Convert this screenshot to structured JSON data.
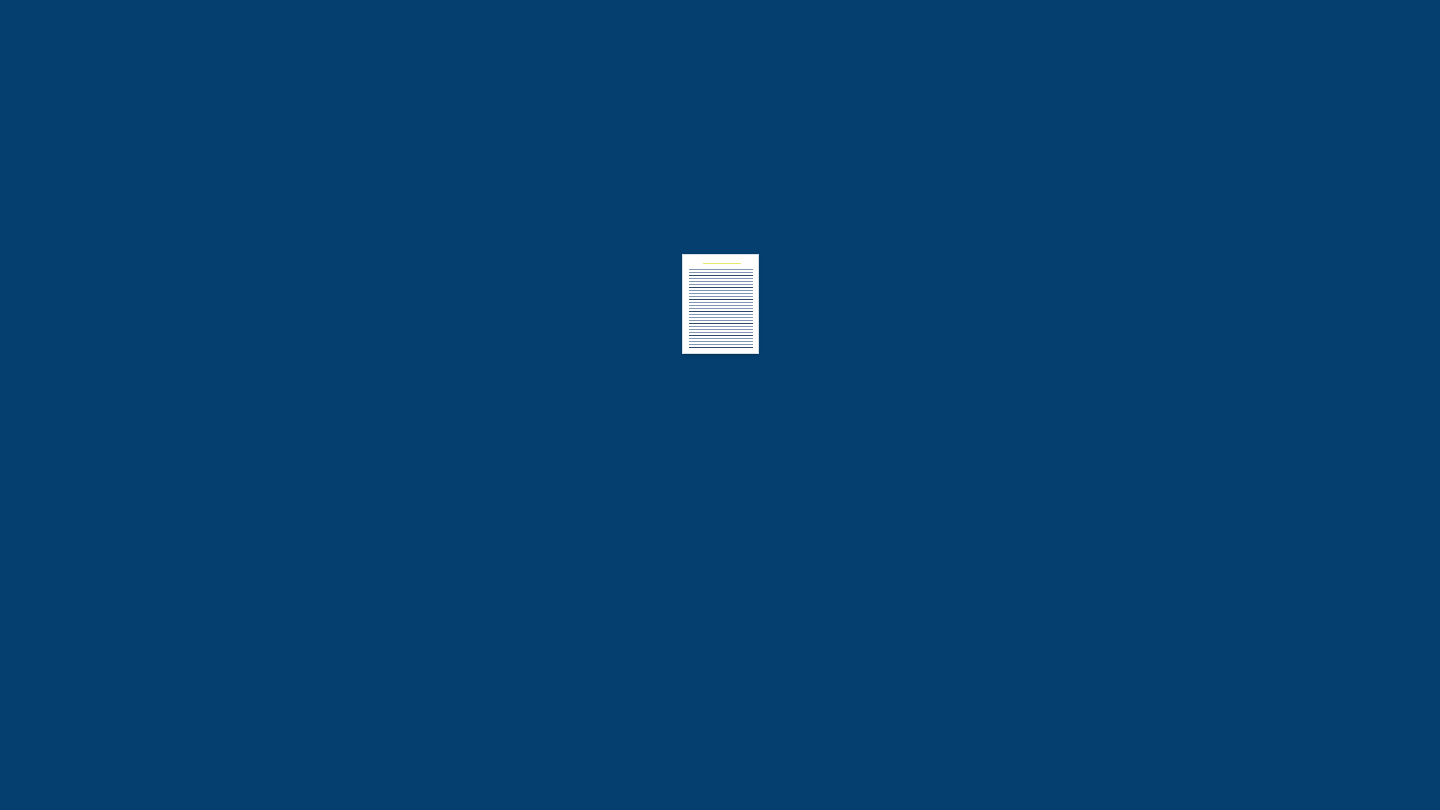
{
  "background_color": "#043f70",
  "document_icon": {
    "name": "document",
    "highlight_color": "#e6ea6a",
    "line_color": "#7f97b2",
    "line_dark_color": "#2d4a6a",
    "line_count": 27
  }
}
